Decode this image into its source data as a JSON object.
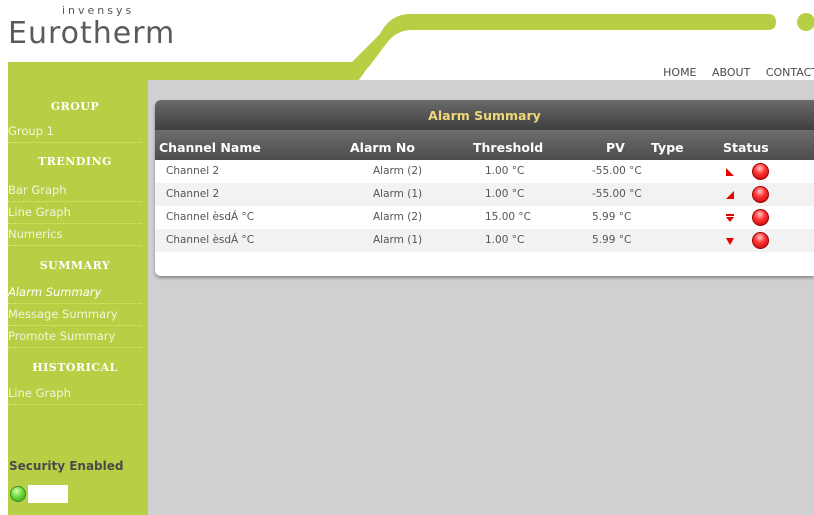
{
  "brand": {
    "tagline": "invensys",
    "name": "Eurotherm"
  },
  "nav": [
    "HOME",
    "ABOUT",
    "CONTACT"
  ],
  "sidebar": {
    "sections": [
      {
        "heading": "GROUP",
        "items": [
          "Group 1"
        ]
      },
      {
        "heading": "TRENDING",
        "items": [
          "Bar Graph",
          "Line Graph",
          "Numerics"
        ]
      },
      {
        "heading": "SUMMARY",
        "items": [
          "Alarm Summary",
          "Message Summary",
          "Promote Summary"
        ]
      },
      {
        "heading": "HISTORICAL",
        "items": [
          "Line Graph"
        ]
      }
    ],
    "active_item": "Alarm Summary",
    "security_label": "Security Enabled"
  },
  "alarm_summary": {
    "title": "Alarm Summary",
    "columns": [
      "Channel Name",
      "Alarm No",
      "Threshold",
      "PV",
      "Type",
      "Status"
    ],
    "rows": [
      {
        "channel": "Channel 2",
        "alarm_no": "Alarm (2)",
        "threshold": "1.00 °C",
        "pv": "-55.00 °C",
        "type_icon": "rate-of-change-falling-icon",
        "status_icon": "alarm-active-red-led-icon"
      },
      {
        "channel": "Channel 2",
        "alarm_no": "Alarm (1)",
        "threshold": "1.00 °C",
        "pv": "-55.00 °C",
        "type_icon": "rate-of-change-rising-icon",
        "status_icon": "alarm-active-red-led-icon"
      },
      {
        "channel": "Channel èsdÁ °C",
        "alarm_no": "Alarm (2)",
        "threshold": "15.00 °C",
        "pv": "5.99 °C",
        "type_icon": "deviation-low-icon",
        "status_icon": "alarm-active-red-led-icon"
      },
      {
        "channel": "Channel èsdÁ °C",
        "alarm_no": "Alarm (1)",
        "threshold": "1.00 °C",
        "pv": "5.99 °C",
        "type_icon": "absolute-low-icon",
        "status_icon": "alarm-active-red-led-icon"
      }
    ]
  },
  "colors": {
    "accent_green": "#b6cf44",
    "title_gold": "#f0d878",
    "alarm_red": "#e60000",
    "security_green": "#6bdc3c"
  }
}
